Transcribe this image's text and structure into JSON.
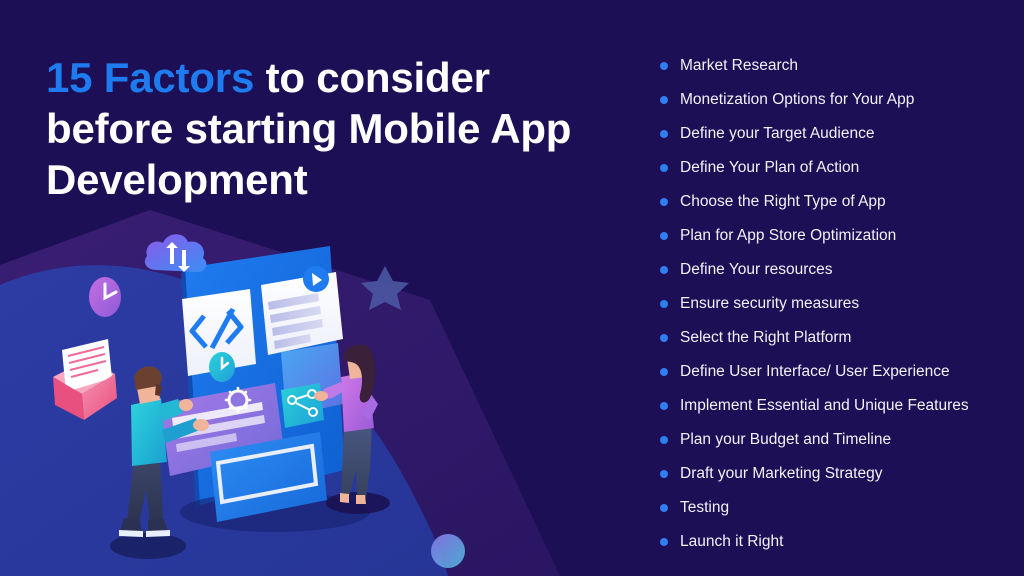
{
  "page": {
    "background_color": "#1d0f55",
    "accent_color": "#1f7cf0",
    "text_color": "#ffffff",
    "bullet_color": "#2f7ff0"
  },
  "headline": {
    "accent_text": "15 Factors",
    "rest_text": " to consider before starting Mobile App Development",
    "full_text": "15 Factors to consider before starting Mobile App Development"
  },
  "factors": [
    {
      "index": 1,
      "label": "Market Research"
    },
    {
      "index": 2,
      "label": "Monetization Options for Your App"
    },
    {
      "index": 3,
      "label": "Define your Target Audience"
    },
    {
      "index": 4,
      "label": "Define Your Plan of Action"
    },
    {
      "index": 5,
      "label": "Choose the Right Type of App"
    },
    {
      "index": 6,
      "label": "Plan for App Store Optimization"
    },
    {
      "index": 7,
      "label": "Define Your resources"
    },
    {
      "index": 8,
      "label": "Ensure security measures"
    },
    {
      "index": 9,
      "label": "Select the Right Platform"
    },
    {
      "index": 10,
      "label": "Define User Interface/ User Experience"
    },
    {
      "index": 11,
      "label": "Implement Essential and Unique Features"
    },
    {
      "index": 12,
      "label": "Plan your Budget and Timeline"
    },
    {
      "index": 13,
      "label": "Draft your Marketing Strategy"
    },
    {
      "index": 14,
      "label": "Testing"
    },
    {
      "index": 15,
      "label": "Launch it Right"
    }
  ],
  "illustration": {
    "description": "Isometric illustration of two people interacting with a large mobile app interface",
    "elements": [
      {
        "name": "cloud-sync-icon",
        "color": "#6a5bf0"
      },
      {
        "name": "clock-icon",
        "color": "#b06ad8"
      },
      {
        "name": "folder-icon",
        "color": "#f06a9a"
      },
      {
        "name": "code-brackets-icon",
        "color": "#1f7cf0"
      },
      {
        "name": "gear-icon",
        "color": "#ffffff"
      },
      {
        "name": "share-icon",
        "color": "#ffffff"
      },
      {
        "name": "play-icon",
        "color": "#ffffff"
      },
      {
        "name": "star-shape",
        "color": "#4f5aa8"
      },
      {
        "name": "circle-shape",
        "color": "#5f7ad8"
      },
      {
        "name": "person-male",
        "color": "#23c4d8"
      },
      {
        "name": "person-female",
        "color": "#b46ae0"
      },
      {
        "name": "floor-shape",
        "color": "#2b3a9e"
      },
      {
        "name": "wedge-shape",
        "color": "#3a1f70"
      }
    ]
  }
}
